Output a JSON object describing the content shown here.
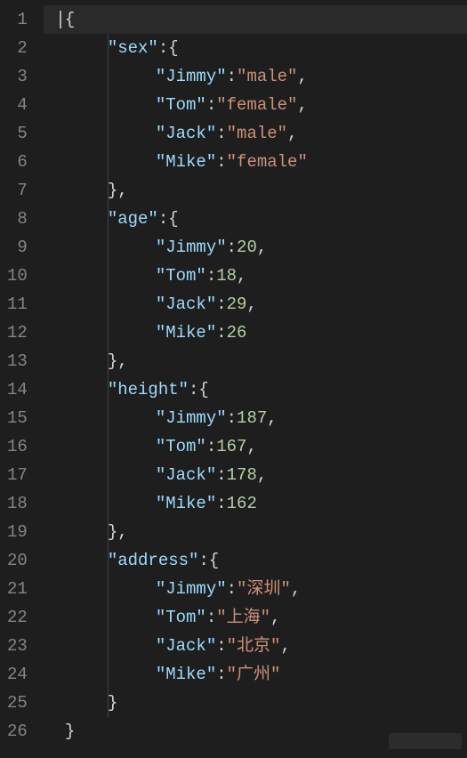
{
  "editor": {
    "lineCount": 26
  },
  "code": {
    "l1_open": "{",
    "sex_key": "\"sex\"",
    "sex_open": ":{",
    "age_key": "\"age\"",
    "age_open": ":{",
    "height_key": "\"height\"",
    "height_open": ":{",
    "address_key": "\"address\"",
    "address_open": ":{",
    "close_comma": "},",
    "close": "}",
    "final_close": "}",
    "jimmy_k": "\"Jimmy\"",
    "tom_k": "\"Tom\"",
    "jack_k": "\"Jack\"",
    "mike_k": "\"Mike\"",
    "colon": ":",
    "comma": ",",
    "sex_jimmy": "\"male\"",
    "sex_tom": "\"female\"",
    "sex_jack": "\"male\"",
    "sex_mike": "\"female\"",
    "age_jimmy": "20",
    "age_tom": "18",
    "age_jack": "29",
    "age_mike": "26",
    "height_jimmy": "187",
    "height_tom": "167",
    "height_jack": "178",
    "height_mike": "162",
    "addr_jimmy": "\"深圳\"",
    "addr_tom": "\"上海\"",
    "addr_jack": "\"北京\"",
    "addr_mike": "\"广州\""
  }
}
